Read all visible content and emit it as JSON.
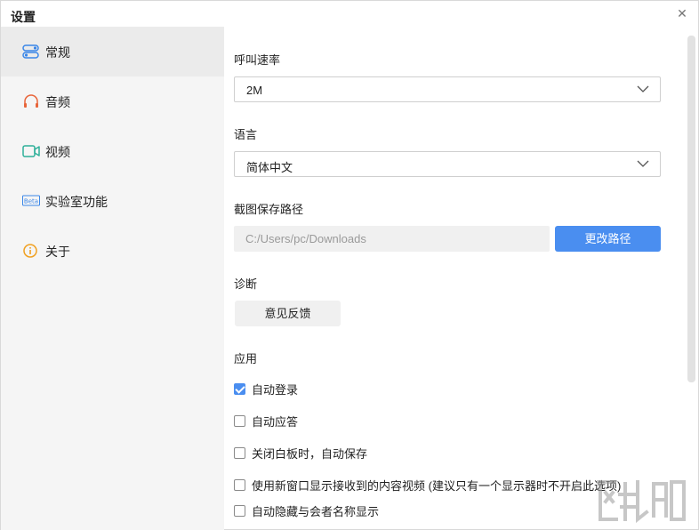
{
  "window": {
    "title": "设置"
  },
  "sidebar": {
    "items": [
      {
        "label": "常规",
        "icon": "toggle-icon",
        "active": true
      },
      {
        "label": "音频",
        "icon": "headphones-icon",
        "active": false
      },
      {
        "label": "视频",
        "icon": "camera-icon",
        "active": false
      },
      {
        "label": "实验室功能",
        "icon": "beta-icon",
        "active": false
      },
      {
        "label": "关于",
        "icon": "info-icon",
        "active": false
      }
    ]
  },
  "general": {
    "call_rate": {
      "label": "呼叫速率",
      "value": "2M"
    },
    "language": {
      "label": "语言",
      "value": "简体中文"
    },
    "screenshot_path": {
      "label": "截图保存路径",
      "value": "C:/Users/pc/Downloads",
      "button": "更改路径"
    },
    "diagnosis": {
      "label": "诊断",
      "button": "意见反馈"
    },
    "app": {
      "label": "应用",
      "options": [
        {
          "label": "自动登录",
          "checked": true
        },
        {
          "label": "自动应答",
          "checked": false
        },
        {
          "label": "关闭白板时，自动保存",
          "checked": false
        },
        {
          "label": "使用新窗口显示接收到的内容视频 (建议只有一个显示器时不开启此选项)",
          "checked": false
        },
        {
          "label": "自动隐藏与会者名称显示",
          "checked": false
        }
      ]
    }
  },
  "colors": {
    "accent": "#4a8ef0",
    "sidebar_bg": "#f5f5f5",
    "sidebar_active": "#ebebeb",
    "input_bg": "#f0f0f0"
  }
}
